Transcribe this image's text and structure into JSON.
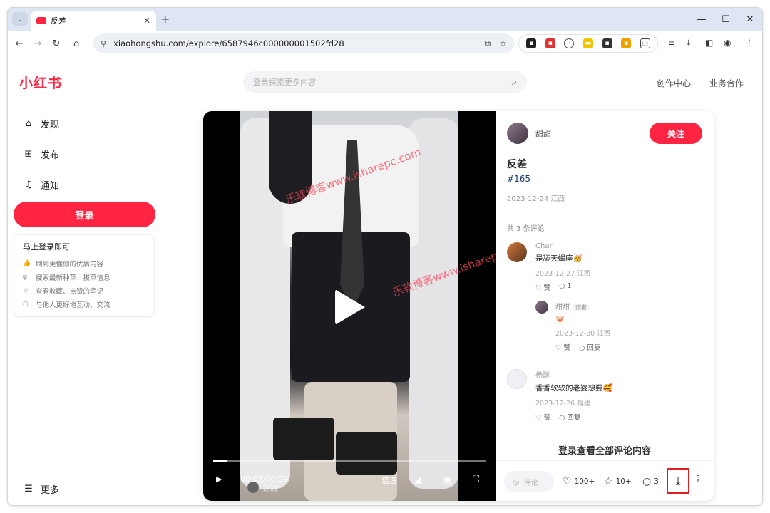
{
  "browser": {
    "tab_title": "反差",
    "new_tab": "+",
    "url": "xiaohongshu.com/explore/6587946c000000001502fd28",
    "controls": {
      "minimize": "—",
      "maximize": "☐",
      "close": "✕"
    }
  },
  "header": {
    "logo": "小红书",
    "search_placeholder": "登录探索更多内容",
    "links": [
      "创作中心",
      "业务合作"
    ]
  },
  "sidebar": {
    "items": [
      {
        "label": "发现",
        "icon": "home-icon"
      },
      {
        "label": "发布",
        "icon": "plus-icon"
      },
      {
        "label": "通知",
        "icon": "bell-icon"
      }
    ],
    "login_button": "登录",
    "login_card": {
      "title": "马上登录即可",
      "items": [
        "刷到更懂你的优质内容",
        "搜索最新种草、拔草信息",
        "查看收藏、点赞的笔记",
        "与他人更好地互动、交流"
      ]
    },
    "more": "更多"
  },
  "video": {
    "current_time": "00:02",
    "duration": "00:09",
    "time_display": "00:02/00:09",
    "progress": 0.05,
    "speed_label": "倍速",
    "author": "甜甜",
    "watermark_1": "乐软博客www.isharepc.com",
    "watermark_2": "乐软博客www.isharepc.com"
  },
  "note": {
    "author": "甜甜",
    "follow_button": "关注",
    "title": "反差",
    "tag": "#165",
    "date": "2023-12-24 江西",
    "comment_count": "共 3 条评论",
    "comments": [
      {
        "name": "Chan",
        "text": "是舔天蝎座🥳",
        "meta": "2023-12-27 江西",
        "like": "赞",
        "reply": "1"
      },
      {
        "name": "甜甜",
        "badge": "作者",
        "text": "🐷",
        "meta": "2023-12-30 江西",
        "like": "赞",
        "reply": "回复"
      },
      {
        "name": "杨酥",
        "text": "香香软软的老婆想要🥰",
        "meta": "2023-12-26 福建",
        "like": "赞",
        "reply": "回复"
      }
    ],
    "see_all": "登录查看全部评论内容",
    "bottom": {
      "comment_placeholder": "评论",
      "likes": "100+",
      "collects": "10+",
      "comments": "3"
    }
  }
}
